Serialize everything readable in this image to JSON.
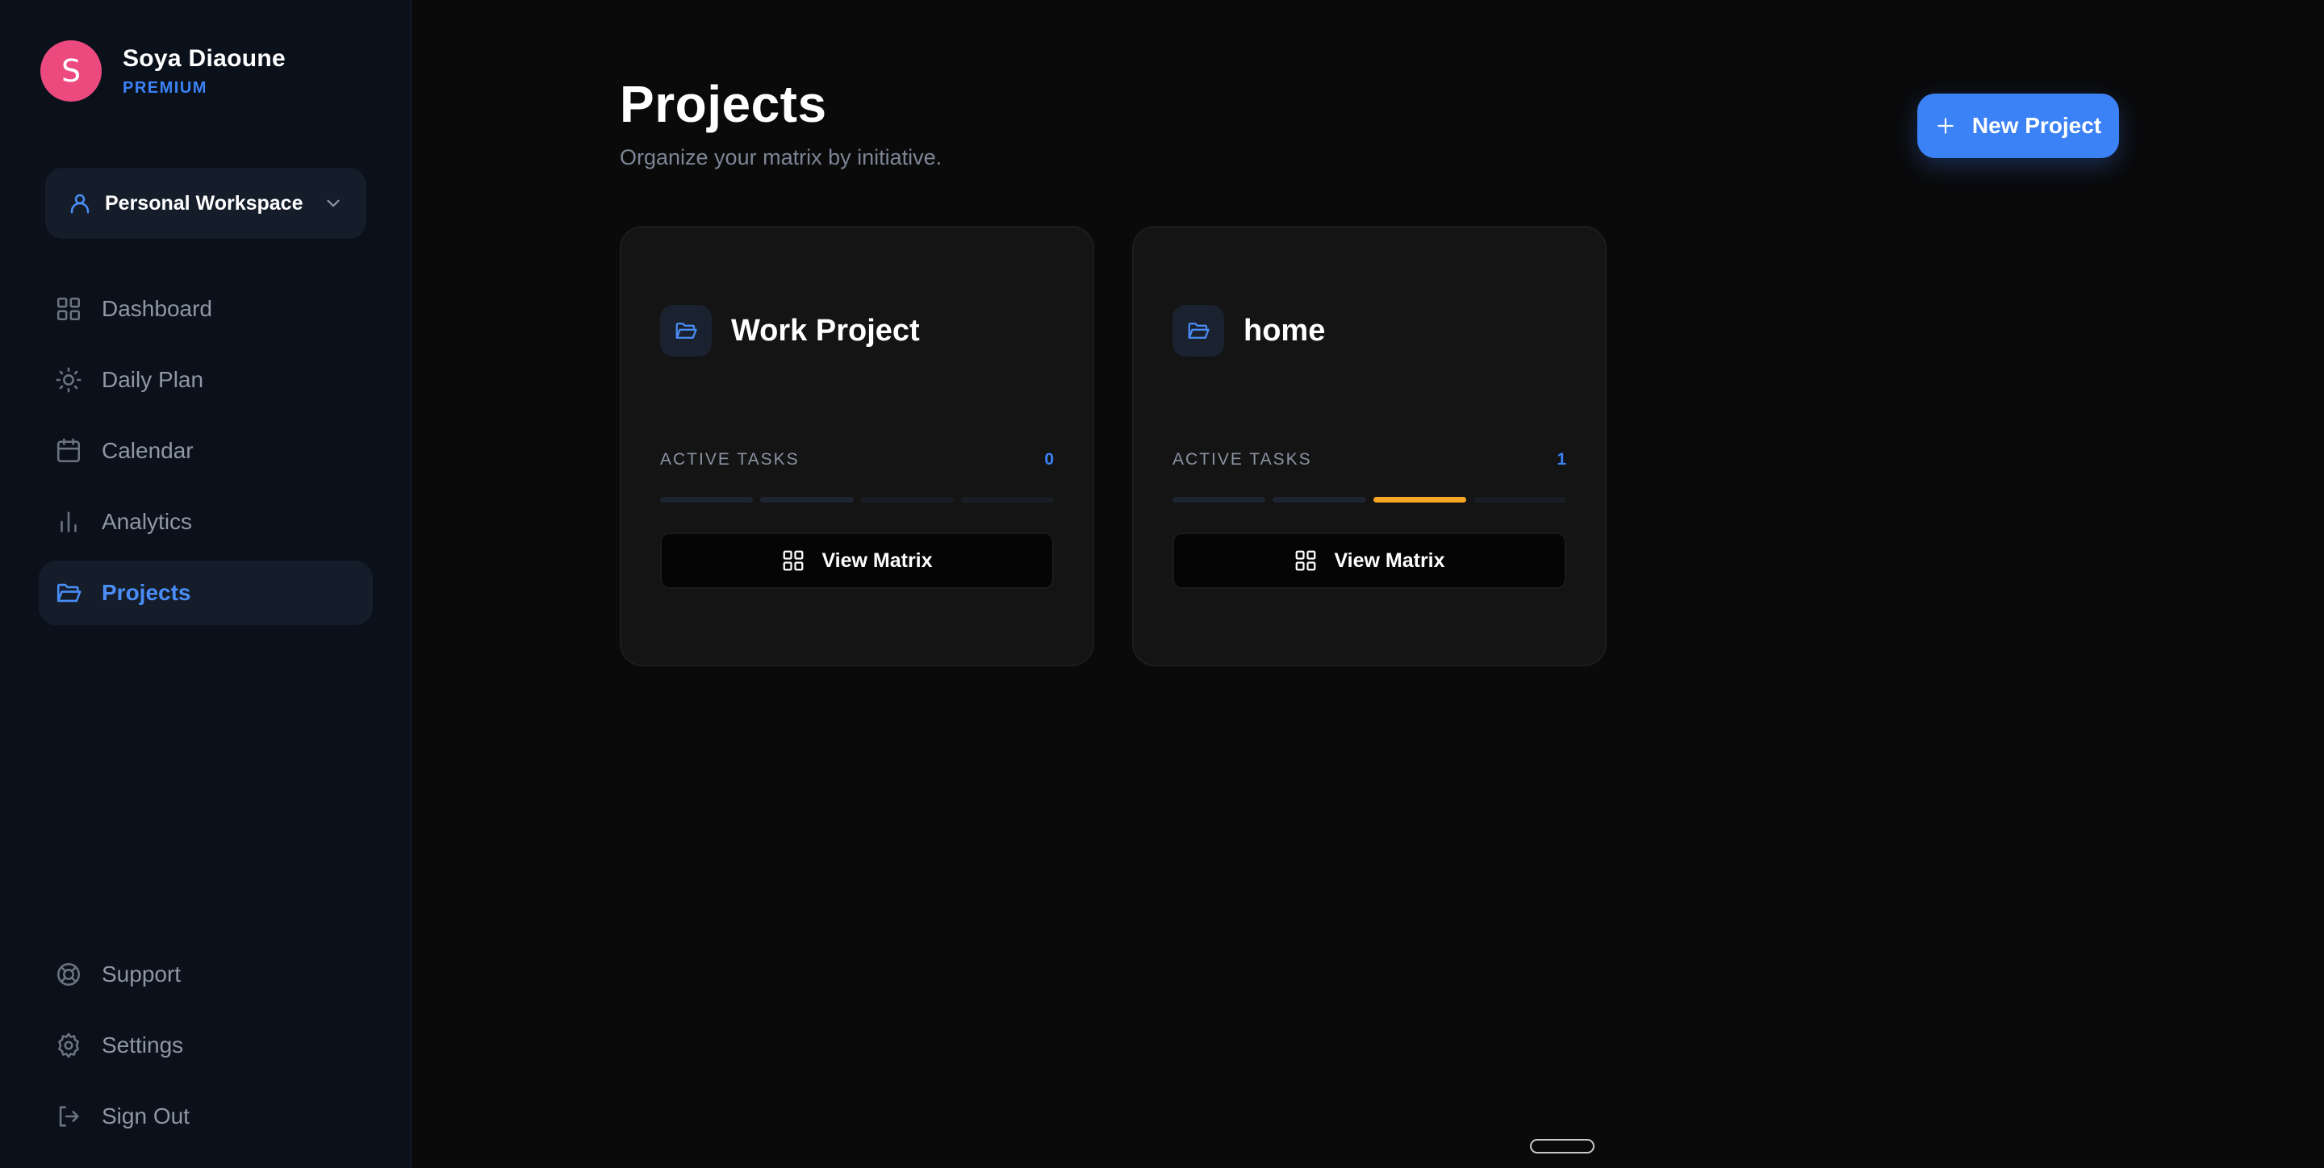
{
  "user": {
    "initial": "S",
    "name": "Soya Diaoune",
    "plan": "PREMIUM"
  },
  "workspace": {
    "label": "Personal Workspace"
  },
  "nav_top": [
    {
      "label": "Dashboard",
      "icon": "grid-icon"
    },
    {
      "label": "Daily Plan",
      "icon": "sun-icon"
    },
    {
      "label": "Calendar",
      "icon": "calendar-icon"
    },
    {
      "label": "Analytics",
      "icon": "bar-chart-icon"
    },
    {
      "label": "Projects",
      "icon": "folder-icon",
      "active": true
    }
  ],
  "nav_bottom": [
    {
      "label": "Support",
      "icon": "lifebuoy-icon"
    },
    {
      "label": "Settings",
      "icon": "gear-icon"
    },
    {
      "label": "Sign Out",
      "icon": "sign-out-icon"
    }
  ],
  "header": {
    "title": "Projects",
    "subtitle": "Organize your matrix by initiative.",
    "new_button": "New Project"
  },
  "projects": [
    {
      "name": "Work Project",
      "tasks_label": "ACTIVE TASKS",
      "active_tasks": "0",
      "view_label": "View Matrix"
    },
    {
      "name": "home",
      "tasks_label": "ACTIVE TASKS",
      "active_tasks": "1",
      "view_label": "View Matrix"
    }
  ],
  "colors": {
    "accent": "#3b82f6",
    "avatar": "#ec4a7e",
    "progress_active": "#f5a623",
    "background": "#0a0a0b",
    "sidebar": "#0b111b"
  }
}
